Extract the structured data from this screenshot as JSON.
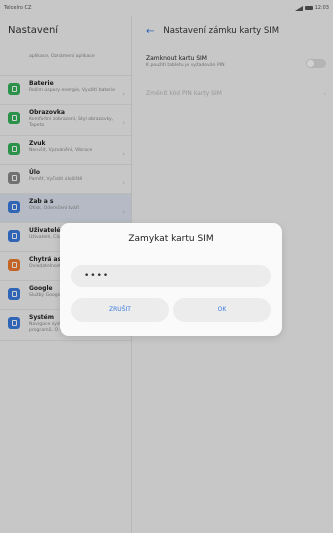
{
  "status_bar": {
    "carrier": "Telcelro CZ",
    "time": "12:03"
  },
  "left_pane": {
    "title": "Nastavení",
    "items": [
      {
        "label": "",
        "desc": "aplikace, Oznámení aplikace",
        "icon": "apps-icon",
        "color": ""
      },
      {
        "label": "Baterie",
        "desc": "Režim úspory energie, Využití baterie",
        "icon": "battery-icon",
        "color": "#34b15a"
      },
      {
        "label": "Obrazovka",
        "desc": "Komfortní zobrazení, Styl obrazovky, Tapeta",
        "icon": "display-icon",
        "color": "#34b15a"
      },
      {
        "label": "Zvuk",
        "desc": "Nerušit, Vyzvánění, Vibrace",
        "icon": "sound-icon",
        "color": "#34b15a"
      },
      {
        "label": "Úlo",
        "desc": "Paměť, Vyčistit úložiště",
        "icon": "storage-icon",
        "color": "#8a8a8a"
      },
      {
        "label": "Zab a s",
        "desc": "Otisk, Odemčení tváří",
        "icon": "security-icon",
        "color": "#3a7be0"
      },
      {
        "label": "Uživatelé a účty",
        "desc": "Uživatelé, Cloud, Účty",
        "icon": "users-icon",
        "color": "#3a7be0"
      },
      {
        "label": "Chytrá asistence",
        "desc": "Ovladatelnost",
        "icon": "assistant-icon",
        "color": "#f07a2f"
      },
      {
        "label": "Google",
        "desc": "Služby Google",
        "icon": "google-icon",
        "color": "#3a7be0"
      },
      {
        "label": "Systém",
        "desc": "Navigace systému, Aktualizace programů, O tabletu, Jazyk a zadávání",
        "icon": "system-icon",
        "color": "#3a7be0"
      }
    ]
  },
  "right_pane": {
    "title": "Nastavení zámku karty SIM",
    "row1": {
      "label": "Zamknout kartu SIM",
      "desc": "K použití tabletu je vyžadován PIN"
    },
    "row2": {
      "label": "Změnit kód PIN karty SIM"
    }
  },
  "dialog": {
    "title": "Zamykat kartu SIM",
    "pin_value": "••••",
    "cancel_label": "ZRUŠIT",
    "ok_label": "OK"
  }
}
